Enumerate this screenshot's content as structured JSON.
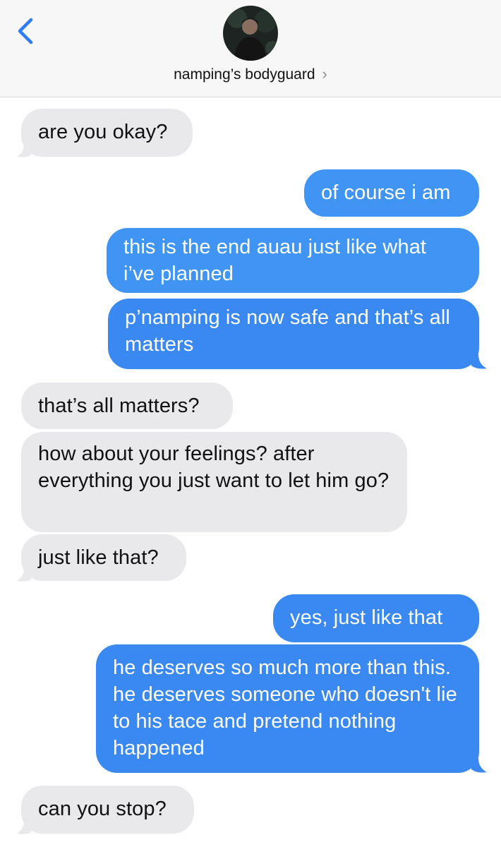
{
  "header": {
    "contact_name": "namping’s bodyguard",
    "back_icon": "chevron-left-icon",
    "detail_icon": "chevron-right-icon",
    "accent_color": "#3f94f4"
  },
  "messages": [
    {
      "from": "them",
      "text": "are you okay?"
    },
    {
      "from": "me",
      "text": "of course i am"
    },
    {
      "from": "me",
      "text": "this is the end auau just like what i’ve planned"
    },
    {
      "from": "me",
      "text": "p’namping is now safe and that’s all matters"
    },
    {
      "from": "them",
      "text": "that’s all matters?"
    },
    {
      "from": "them",
      "text": "how about your feelings? after everything you just want to let him go?"
    },
    {
      "from": "them",
      "text": "just like that?"
    },
    {
      "from": "me",
      "text": "yes, just like that"
    },
    {
      "from": "me",
      "text": "he deserves so much more than this. he deserves someone who doesn't lie to his tace and pretend nothing happened"
    },
    {
      "from": "them",
      "text": "can you stop?"
    }
  ]
}
